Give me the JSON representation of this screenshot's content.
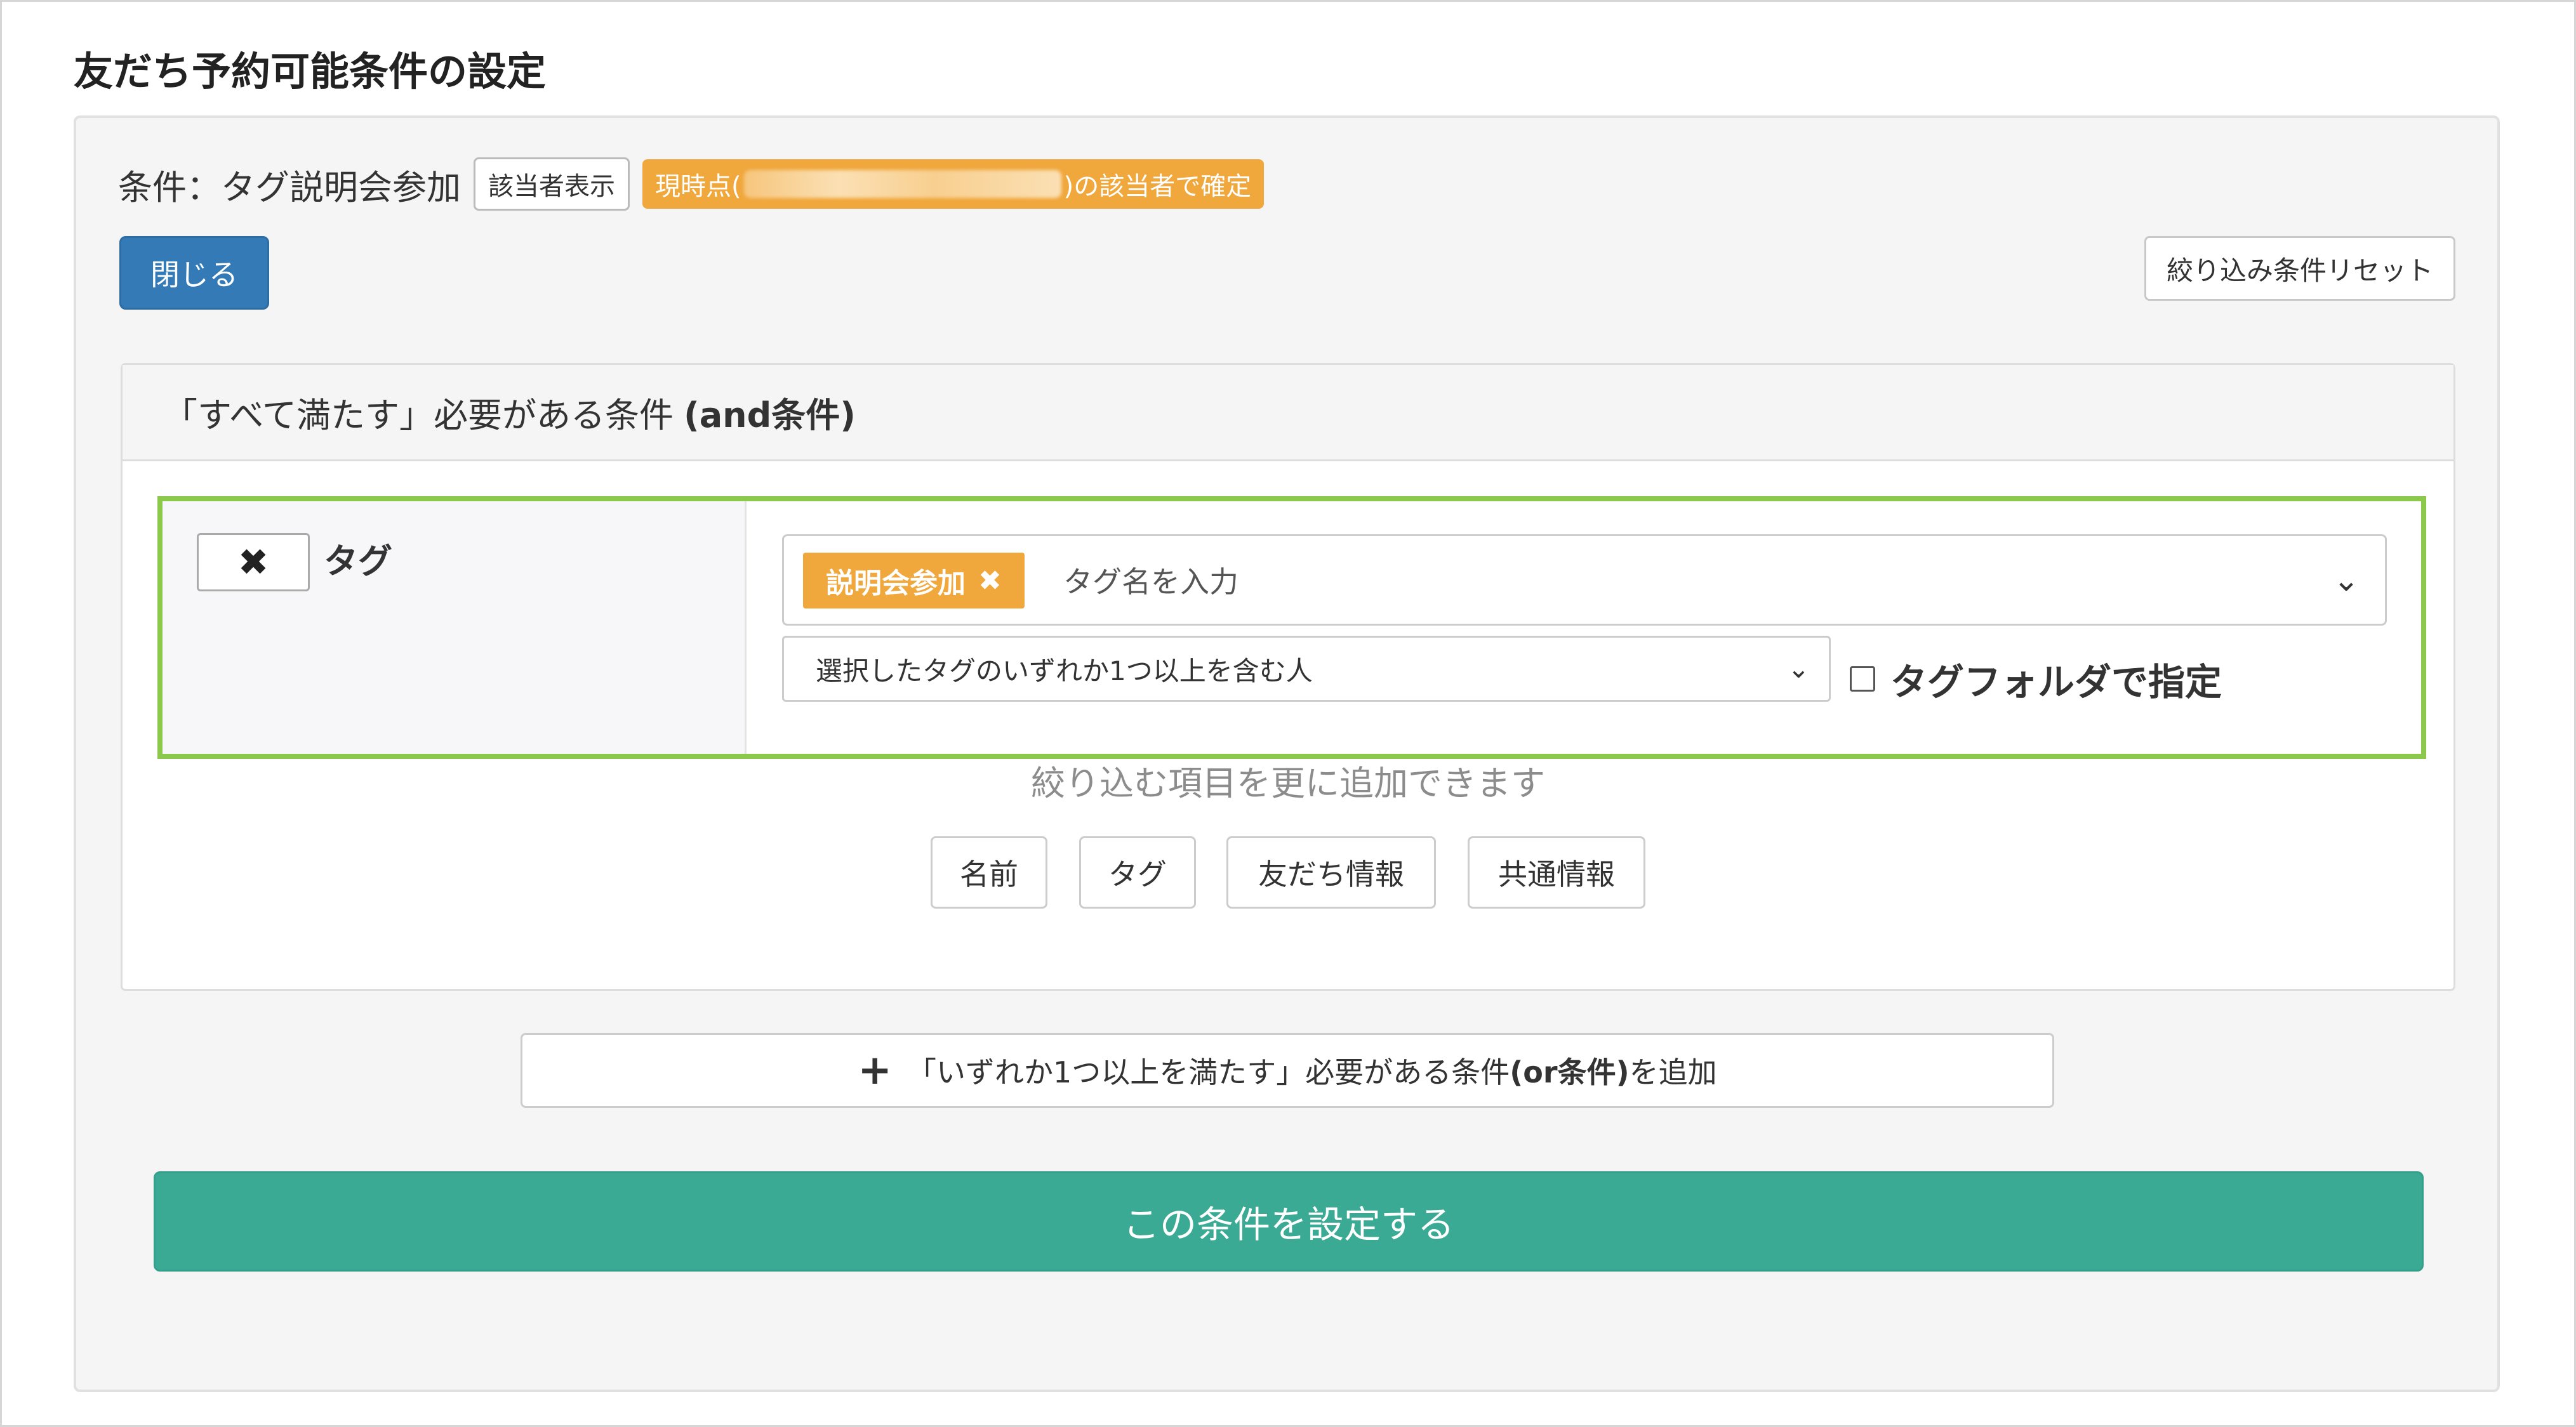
{
  "page": {
    "title": "友だち予約可能条件の設定"
  },
  "condition": {
    "text": "条件：タグ説明会参加",
    "show_button": "該当者表示",
    "badge_prefix": "現時点(",
    "badge_suffix": ")の該当者で確定"
  },
  "buttons": {
    "close": "閉じる",
    "reset": "絞り込み条件リセット"
  },
  "and_section": {
    "header": "「すべて満たす」必要がある条件",
    "header_bold": "(and条件)",
    "tag_row": {
      "remove_icon": "✖",
      "label": "タグ",
      "chip_label": "説明会参加",
      "chip_remove": "✖",
      "placeholder": "タグ名を入力",
      "dropdown_icon": "⌄",
      "match_select": "選択したタグのいずれか1つ以上を含む人",
      "select_icon": "⌄",
      "folder_label": "タグフォルダで指定",
      "folder_checked": false
    },
    "add_hint": "絞り込む項目を更に追加できます",
    "add_buttons": [
      "名前",
      "タグ",
      "友だち情報",
      "共通情報"
    ]
  },
  "or_button": {
    "plus": "+",
    "label_pre": "「いずれか1つ以上を満たす」必要がある条件",
    "label_bold": "(or条件)",
    "label_post": "を追加"
  },
  "submit": {
    "label": "この条件を設定する"
  },
  "colors": {
    "primary": "#337ab7",
    "orange": "#f0a73c",
    "highlight_border": "#8cc84b",
    "submit": "#3aaa94"
  }
}
